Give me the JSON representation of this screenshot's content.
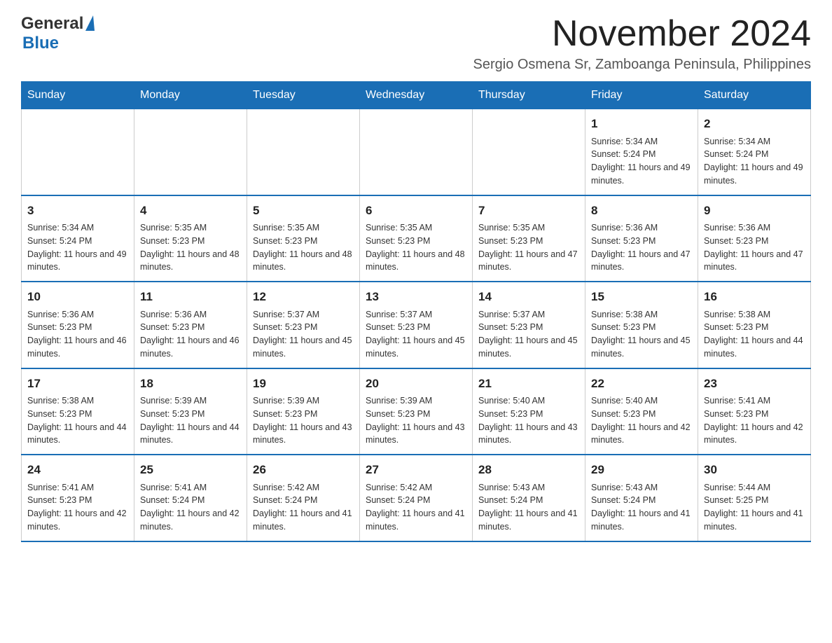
{
  "header": {
    "logo_general": "General",
    "logo_blue": "Blue",
    "main_title": "November 2024",
    "subtitle": "Sergio Osmena Sr, Zamboanga Peninsula, Philippines"
  },
  "calendar": {
    "days_of_week": [
      "Sunday",
      "Monday",
      "Tuesday",
      "Wednesday",
      "Thursday",
      "Friday",
      "Saturday"
    ],
    "weeks": [
      [
        {
          "day": "",
          "info": ""
        },
        {
          "day": "",
          "info": ""
        },
        {
          "day": "",
          "info": ""
        },
        {
          "day": "",
          "info": ""
        },
        {
          "day": "",
          "info": ""
        },
        {
          "day": "1",
          "info": "Sunrise: 5:34 AM\nSunset: 5:24 PM\nDaylight: 11 hours and 49 minutes."
        },
        {
          "day": "2",
          "info": "Sunrise: 5:34 AM\nSunset: 5:24 PM\nDaylight: 11 hours and 49 minutes."
        }
      ],
      [
        {
          "day": "3",
          "info": "Sunrise: 5:34 AM\nSunset: 5:24 PM\nDaylight: 11 hours and 49 minutes."
        },
        {
          "day": "4",
          "info": "Sunrise: 5:35 AM\nSunset: 5:23 PM\nDaylight: 11 hours and 48 minutes."
        },
        {
          "day": "5",
          "info": "Sunrise: 5:35 AM\nSunset: 5:23 PM\nDaylight: 11 hours and 48 minutes."
        },
        {
          "day": "6",
          "info": "Sunrise: 5:35 AM\nSunset: 5:23 PM\nDaylight: 11 hours and 48 minutes."
        },
        {
          "day": "7",
          "info": "Sunrise: 5:35 AM\nSunset: 5:23 PM\nDaylight: 11 hours and 47 minutes."
        },
        {
          "day": "8",
          "info": "Sunrise: 5:36 AM\nSunset: 5:23 PM\nDaylight: 11 hours and 47 minutes."
        },
        {
          "day": "9",
          "info": "Sunrise: 5:36 AM\nSunset: 5:23 PM\nDaylight: 11 hours and 47 minutes."
        }
      ],
      [
        {
          "day": "10",
          "info": "Sunrise: 5:36 AM\nSunset: 5:23 PM\nDaylight: 11 hours and 46 minutes."
        },
        {
          "day": "11",
          "info": "Sunrise: 5:36 AM\nSunset: 5:23 PM\nDaylight: 11 hours and 46 minutes."
        },
        {
          "day": "12",
          "info": "Sunrise: 5:37 AM\nSunset: 5:23 PM\nDaylight: 11 hours and 45 minutes."
        },
        {
          "day": "13",
          "info": "Sunrise: 5:37 AM\nSunset: 5:23 PM\nDaylight: 11 hours and 45 minutes."
        },
        {
          "day": "14",
          "info": "Sunrise: 5:37 AM\nSunset: 5:23 PM\nDaylight: 11 hours and 45 minutes."
        },
        {
          "day": "15",
          "info": "Sunrise: 5:38 AM\nSunset: 5:23 PM\nDaylight: 11 hours and 45 minutes."
        },
        {
          "day": "16",
          "info": "Sunrise: 5:38 AM\nSunset: 5:23 PM\nDaylight: 11 hours and 44 minutes."
        }
      ],
      [
        {
          "day": "17",
          "info": "Sunrise: 5:38 AM\nSunset: 5:23 PM\nDaylight: 11 hours and 44 minutes."
        },
        {
          "day": "18",
          "info": "Sunrise: 5:39 AM\nSunset: 5:23 PM\nDaylight: 11 hours and 44 minutes."
        },
        {
          "day": "19",
          "info": "Sunrise: 5:39 AM\nSunset: 5:23 PM\nDaylight: 11 hours and 43 minutes."
        },
        {
          "day": "20",
          "info": "Sunrise: 5:39 AM\nSunset: 5:23 PM\nDaylight: 11 hours and 43 minutes."
        },
        {
          "day": "21",
          "info": "Sunrise: 5:40 AM\nSunset: 5:23 PM\nDaylight: 11 hours and 43 minutes."
        },
        {
          "day": "22",
          "info": "Sunrise: 5:40 AM\nSunset: 5:23 PM\nDaylight: 11 hours and 42 minutes."
        },
        {
          "day": "23",
          "info": "Sunrise: 5:41 AM\nSunset: 5:23 PM\nDaylight: 11 hours and 42 minutes."
        }
      ],
      [
        {
          "day": "24",
          "info": "Sunrise: 5:41 AM\nSunset: 5:23 PM\nDaylight: 11 hours and 42 minutes."
        },
        {
          "day": "25",
          "info": "Sunrise: 5:41 AM\nSunset: 5:24 PM\nDaylight: 11 hours and 42 minutes."
        },
        {
          "day": "26",
          "info": "Sunrise: 5:42 AM\nSunset: 5:24 PM\nDaylight: 11 hours and 41 minutes."
        },
        {
          "day": "27",
          "info": "Sunrise: 5:42 AM\nSunset: 5:24 PM\nDaylight: 11 hours and 41 minutes."
        },
        {
          "day": "28",
          "info": "Sunrise: 5:43 AM\nSunset: 5:24 PM\nDaylight: 11 hours and 41 minutes."
        },
        {
          "day": "29",
          "info": "Sunrise: 5:43 AM\nSunset: 5:24 PM\nDaylight: 11 hours and 41 minutes."
        },
        {
          "day": "30",
          "info": "Sunrise: 5:44 AM\nSunset: 5:25 PM\nDaylight: 11 hours and 41 minutes."
        }
      ]
    ]
  }
}
